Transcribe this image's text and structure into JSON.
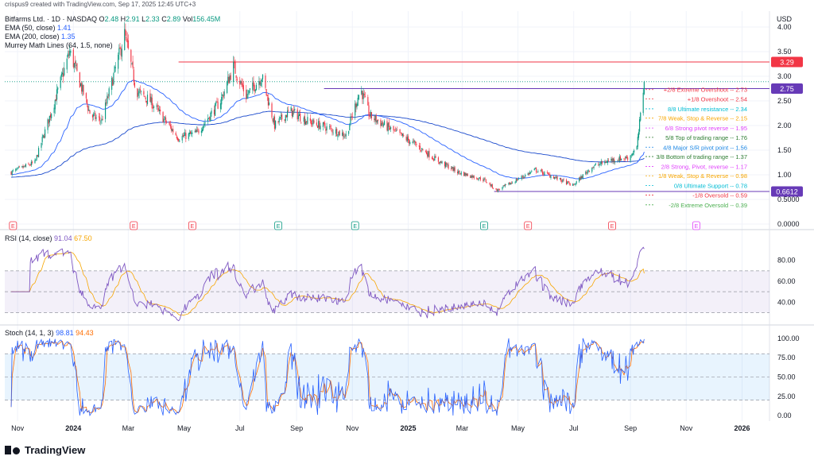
{
  "header": {
    "credit": "crispus9 created with TradingView.com, Sep 17, 2025 12:45 UTC+3",
    "symbol": "Bitfarms Ltd. · 1D · NASDAQ",
    "ohlc": {
      "o_label": "O",
      "o": "2.48",
      "h_label": "H",
      "h": "2.91",
      "l_label": "L",
      "l": "2.33",
      "c_label": "C",
      "c": "2.89",
      "vol_label": "Vol",
      "vol": "156.45M"
    },
    "ema50": {
      "label": "EMA (50, close)",
      "value": "1.41"
    },
    "ema200": {
      "label": "EMA (200, close)",
      "value": "1.35"
    },
    "murrey": {
      "label": "Murrey Math Lines (64, 1.5, none)"
    },
    "currency": "USD"
  },
  "brand": {
    "name": "TradingView"
  },
  "colors": {
    "up": "#089981",
    "down": "#f23645",
    "ema50": "#2962ff",
    "ema200": "#1848cc",
    "rsi": "#7e57c2",
    "rsi_ma": "#f7a600",
    "stoch_k": "#2962ff",
    "stoch_d": "#ff6d00",
    "band_rsi": "#7e57c2",
    "band_stoch": "#2196f3"
  },
  "chart_data": [
    {
      "type": "candlestick",
      "price_axis": {
        "ticks": [
          "4.00",
          "3.50",
          "3.00",
          "2.50",
          "2.00",
          "1.50",
          "1.00",
          "0.5000",
          "0.0000"
        ],
        "ylim": [
          0,
          4
        ]
      },
      "time_axis": {
        "labels": [
          "Nov",
          "2024",
          "Mar",
          "May",
          "Jul",
          "Sep",
          "Nov",
          "2025",
          "Mar",
          "May",
          "Jul",
          "Sep",
          "Nov",
          "2026"
        ]
      },
      "anchors": [
        {
          "date": "2023-10-25",
          "close": 1.05
        },
        {
          "date": "2023-11-20",
          "close": 1.25
        },
        {
          "date": "2023-12-10",
          "close": 2.4
        },
        {
          "date": "2023-12-28",
          "close": 3.5
        },
        {
          "date": "2024-01-20",
          "close": 2.2
        },
        {
          "date": "2024-02-01",
          "close": 2.1
        },
        {
          "date": "2024-02-26",
          "close": 3.85
        },
        {
          "date": "2024-03-10",
          "close": 2.7
        },
        {
          "date": "2024-03-25",
          "close": 2.5
        },
        {
          "date": "2024-04-10",
          "close": 2.1
        },
        {
          "date": "2024-04-25",
          "close": 1.75
        },
        {
          "date": "2024-05-15",
          "close": 1.85
        },
        {
          "date": "2024-06-10",
          "close": 2.5
        },
        {
          "date": "2024-06-24",
          "close": 3.2
        },
        {
          "date": "2024-07-08",
          "close": 2.6
        },
        {
          "date": "2024-07-25",
          "close": 3.0
        },
        {
          "date": "2024-08-08",
          "close": 2.0
        },
        {
          "date": "2024-08-25",
          "close": 2.3
        },
        {
          "date": "2024-09-12",
          "close": 2.1
        },
        {
          "date": "2024-10-05",
          "close": 1.95
        },
        {
          "date": "2024-10-25",
          "close": 1.8
        },
        {
          "date": "2024-11-10",
          "close": 2.75
        },
        {
          "date": "2024-11-20",
          "close": 2.2
        },
        {
          "date": "2024-12-15",
          "close": 1.9
        },
        {
          "date": "2025-01-10",
          "close": 1.6
        },
        {
          "date": "2025-02-01",
          "close": 1.3
        },
        {
          "date": "2025-02-25",
          "close": 1.05
        },
        {
          "date": "2025-03-25",
          "close": 0.9
        },
        {
          "date": "2025-04-08",
          "close": 0.68
        },
        {
          "date": "2025-04-25",
          "close": 0.85
        },
        {
          "date": "2025-05-20",
          "close": 1.1
        },
        {
          "date": "2025-06-10",
          "close": 0.95
        },
        {
          "date": "2025-06-30",
          "close": 0.78
        },
        {
          "date": "2025-07-20",
          "close": 1.15
        },
        {
          "date": "2025-08-10",
          "close": 1.3
        },
        {
          "date": "2025-08-30",
          "close": 1.35
        },
        {
          "date": "2025-09-08",
          "close": 1.55
        },
        {
          "date": "2025-09-12",
          "close": 2.2
        },
        {
          "date": "2025-09-16",
          "close": 2.89
        }
      ],
      "murrey_lines": [
        {
          "label": "+2/8 Extreme Overshoot",
          "value": "2.73",
          "v": 2.73,
          "color": "#f23645"
        },
        {
          "label": "+1/8 Overshoot",
          "value": "2.54",
          "v": 2.54,
          "color": "#f23645"
        },
        {
          "label": "8/8 Ultimate resistance",
          "value": "2.34",
          "v": 2.34,
          "color": "#00bcd4"
        },
        {
          "label": "7/8 Weak, Stop & Reverse",
          "value": "2.15",
          "v": 2.15,
          "color": "#f7a600"
        },
        {
          "label": "6/8 Strong pivot reverse",
          "value": "1.95",
          "v": 1.95,
          "color": "#e040fb"
        },
        {
          "label": "5/8 Top of trading range",
          "value": "1.76",
          "v": 1.76,
          "color": "#2e7d32"
        },
        {
          "label": "4/8 Major S/R pivot point",
          "value": "1.56",
          "v": 1.56,
          "color": "#1e88e5"
        },
        {
          "label": "3/8 Bottom of trading range",
          "value": "1.37",
          "v": 1.37,
          "color": "#2e7d32"
        },
        {
          "label": "2/8 Strong, Pivot, reverse",
          "value": "1.17",
          "v": 1.17,
          "color": "#e040fb"
        },
        {
          "label": "1/8 Weak, Stop & Reverse",
          "value": "0.98",
          "v": 0.98,
          "color": "#f7a600"
        },
        {
          "label": "0/8 Ultimate Support",
          "value": "0.78",
          "v": 0.78,
          "color": "#00bcd4"
        },
        {
          "label": "-1/8 Oversold",
          "value": "0.59",
          "v": 0.59,
          "color": "#f23645"
        },
        {
          "label": "-2/8 Extreme Oversold",
          "value": "0.39",
          "v": 0.39,
          "color": "#4caf50"
        }
      ],
      "horizontal_lines": [
        {
          "value": 3.29,
          "label": "3.29",
          "color": "#f23645",
          "from": "2024-04-25"
        },
        {
          "value": 2.75,
          "label": "2.75",
          "color": "#673ab7",
          "from": "2024-10-01"
        },
        {
          "value": 0.6612,
          "label": "0.6612",
          "color": "#673ab7",
          "from": "2025-04-05"
        }
      ],
      "event_markers": [
        {
          "date": "2023-10-27",
          "label": "E",
          "color": "#f23645"
        },
        {
          "date": "2024-03-07",
          "label": "E",
          "color": "#f23645"
        },
        {
          "date": "2024-05-10",
          "label": "E",
          "color": "#f23645"
        },
        {
          "date": "2024-08-12",
          "label": "E",
          "color": "#089981"
        },
        {
          "date": "2024-11-04",
          "label": "E",
          "color": "#089981"
        },
        {
          "date": "2025-03-25",
          "label": "E",
          "color": "#089981"
        },
        {
          "date": "2025-05-12",
          "label": "E",
          "color": "#f23645"
        },
        {
          "date": "2025-08-12",
          "label": "E",
          "color": "#f23645"
        },
        {
          "date": "2025-11-12",
          "label": "E",
          "color": "#e040fb"
        }
      ]
    },
    {
      "type": "line",
      "name": "RSI",
      "legend": {
        "label": "RSI (14, close)",
        "rsi": "91.04",
        "ma": "67.50"
      },
      "ticks": [
        "80.00",
        "60.00",
        "40.00"
      ],
      "ylim": [
        22,
        98
      ],
      "bands": [
        70,
        50,
        30
      ]
    },
    {
      "type": "line",
      "name": "Stoch",
      "legend": {
        "label": "Stoch (14, 1, 3)",
        "k": "98.81",
        "d": "94.43"
      },
      "ticks": [
        "100.00",
        "75.00",
        "50.00",
        "25.00",
        "0.00"
      ],
      "ylim": [
        -3,
        108
      ],
      "bands": [
        80,
        50,
        20
      ]
    }
  ]
}
